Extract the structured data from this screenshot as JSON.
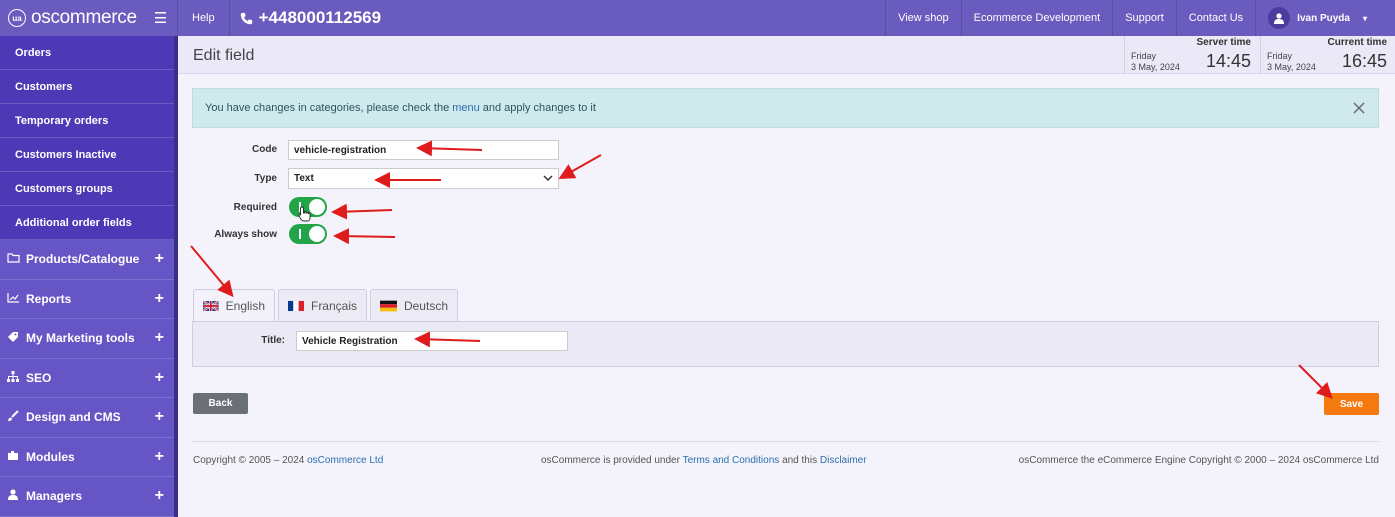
{
  "topbar": {
    "logo_text": "oscommerce",
    "logo_badge": "ua",
    "help": "Help",
    "phone": "+448000112569",
    "links": [
      "View shop",
      "Ecommerce Development",
      "Support",
      "Contact Us"
    ],
    "user_name": "Ivan Puyda"
  },
  "sidebar": {
    "sub_items": [
      "Orders",
      "Customers",
      "Temporary orders",
      "Customers Inactive",
      "Customers groups",
      "Additional order fields"
    ],
    "main_items": [
      {
        "label": "Products/Catalogue",
        "icon": "folder-icon"
      },
      {
        "label": "Reports",
        "icon": "chart-icon"
      },
      {
        "label": "My Marketing tools",
        "icon": "tag-icon"
      },
      {
        "label": "SEO",
        "icon": "sitemap-icon"
      },
      {
        "label": "Design and CMS",
        "icon": "brush-icon"
      },
      {
        "label": "Modules",
        "icon": "puzzle-icon"
      },
      {
        "label": "Managers",
        "icon": "user-icon"
      }
    ]
  },
  "header": {
    "title": "Edit field",
    "server": {
      "label": "Server time",
      "day": "Friday",
      "date": "3 May, 2024",
      "time": "14:45"
    },
    "current": {
      "label": "Current time",
      "day": "Friday",
      "date": "3 May, 2024",
      "time": "16:45"
    }
  },
  "alert": {
    "before": "You have changes in categories, please check the",
    "link": "menu",
    "after": "and apply changes to it"
  },
  "form": {
    "code_label": "Code",
    "code_value": "vehicle-registration",
    "type_label": "Type",
    "type_value": "Text",
    "required_label": "Required",
    "required_on": true,
    "always_label": "Always show",
    "always_on": true
  },
  "tabs": [
    "English",
    "Français",
    "Deutsch"
  ],
  "panel": {
    "title_label": "Title:",
    "title_value": "Vehicle Registration"
  },
  "buttons": {
    "back": "Back",
    "save": "Save"
  },
  "footer": {
    "left_text": "Copyright © 2005 – 2024",
    "left_link": "osCommerce Ltd",
    "mid_before": "osCommerce is provided under",
    "mid_link1": "Terms and Conditions",
    "mid_between": "and this",
    "mid_link2": "Disclaimer",
    "right_text": "osCommerce the eCommerce Engine Copyright © 2000 – 2024 osCommerce Ltd"
  },
  "colors": {
    "topbar": "#6a5bbe",
    "sidebar": "#4c3aa8",
    "toggle_on": "#24a448",
    "save": "#f4790f",
    "annotation": "#e01b1b"
  }
}
